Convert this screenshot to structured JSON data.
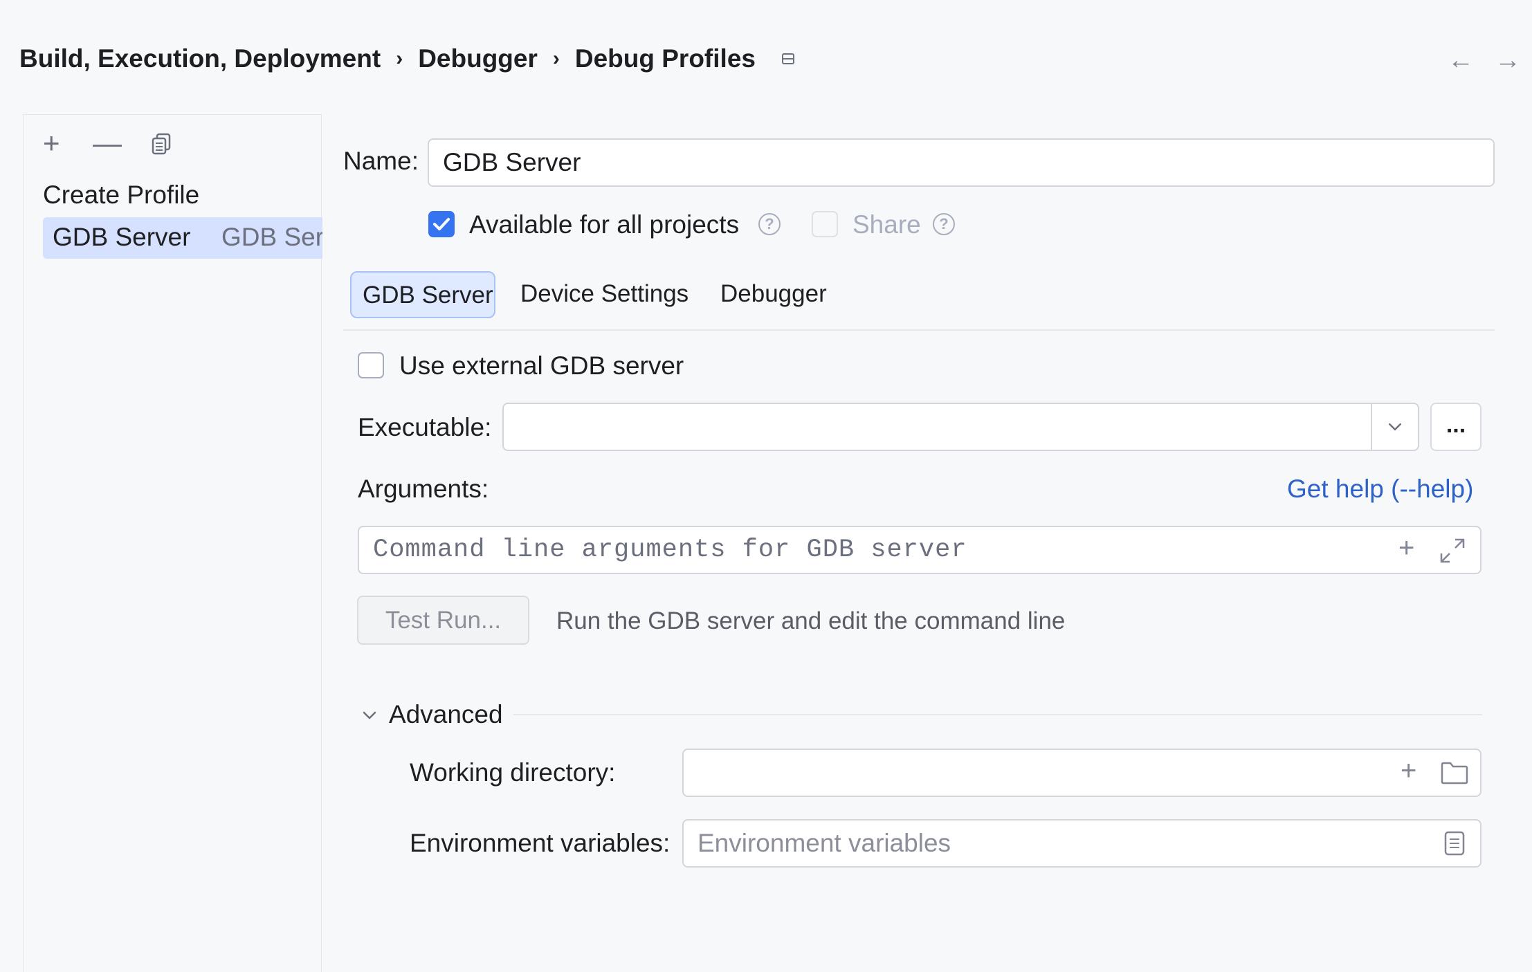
{
  "breadcrumb": {
    "items": [
      "Build, Execution, Deployment",
      "Debugger",
      "Debug Profiles"
    ],
    "separator": "›"
  },
  "nav": {
    "back": "←",
    "forward": "→"
  },
  "left_panel": {
    "toolbar": {
      "add": "+",
      "remove": "—"
    },
    "items": [
      {
        "label": "Create Profile",
        "sublabel": ""
      },
      {
        "label": "GDB Server",
        "sublabel": "GDB Server"
      }
    ]
  },
  "form": {
    "name_label": "Name:",
    "name_value": "GDB Server",
    "available_label": "Available for all projects",
    "available_checked": true,
    "share_label": "Share",
    "share_checked": false,
    "help_glyph": "?"
  },
  "tabs": [
    {
      "label": "GDB Server",
      "selected": true
    },
    {
      "label": "Device Settings",
      "selected": false
    },
    {
      "label": "Debugger",
      "selected": false
    }
  ],
  "gdb_server": {
    "use_external_label": "Use external GDB server",
    "use_external_checked": false,
    "executable_label": "Executable:",
    "executable_value": "",
    "browse_label": "...",
    "arguments_label": "Arguments:",
    "get_help_link": "Get help (--help)",
    "arguments_placeholder": "Command line arguments for GDB server",
    "test_run_label": "Test Run...",
    "test_run_hint": "Run the GDB server and edit the command line"
  },
  "advanced": {
    "title": "Advanced",
    "expanded": true,
    "working_dir_label": "Working directory:",
    "working_dir_value": "",
    "env_label": "Environment variables:",
    "env_placeholder": "Environment variables"
  },
  "colors": {
    "accent": "#3574f0",
    "link": "#2e62c9",
    "selection": "#d5e1ff",
    "background": "#f7f8fa"
  }
}
